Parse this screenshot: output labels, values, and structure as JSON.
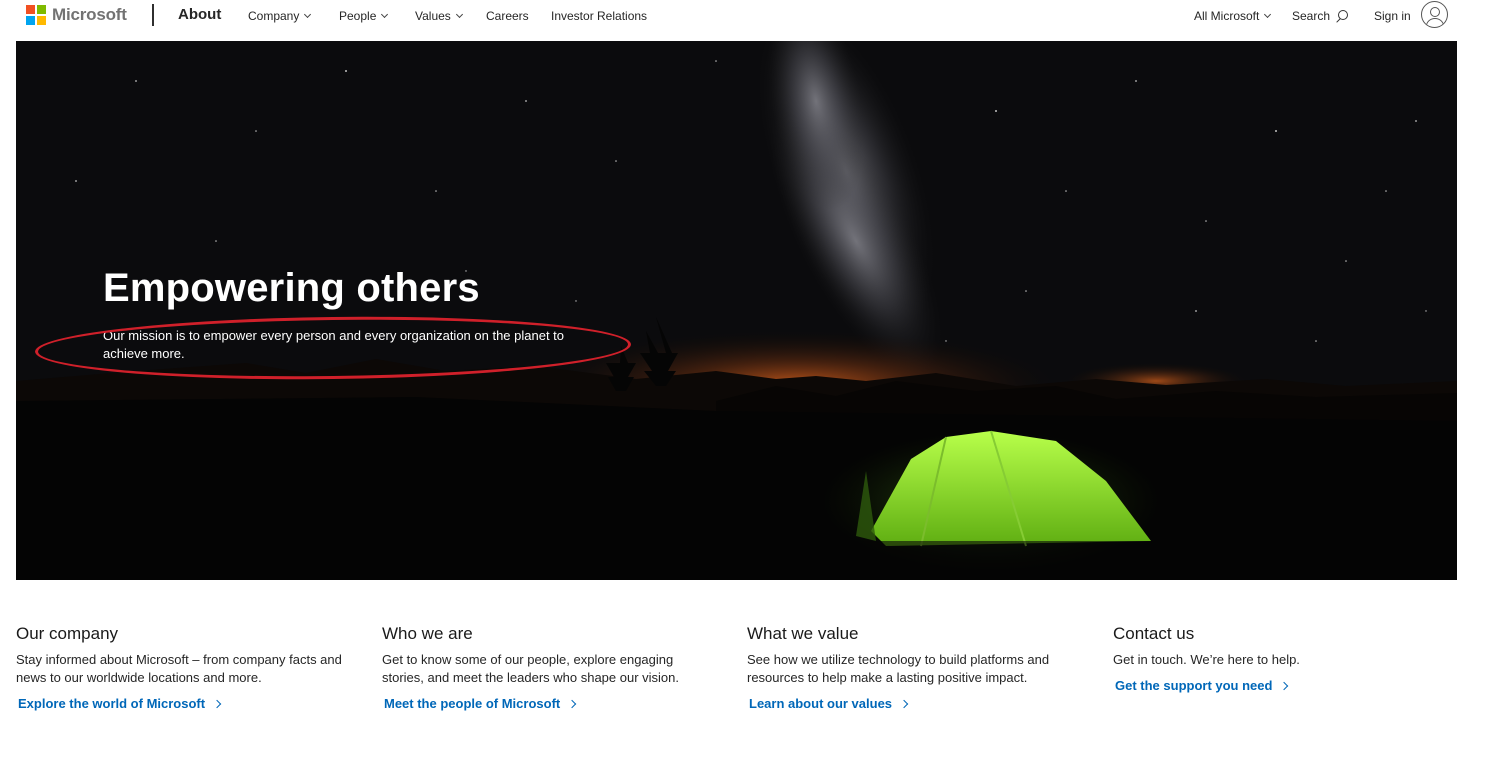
{
  "header": {
    "logo_text": "Microsoft",
    "site_title": "About",
    "nav": [
      {
        "label": "Company",
        "has_dropdown": true
      },
      {
        "label": "People",
        "has_dropdown": true
      },
      {
        "label": "Values",
        "has_dropdown": true
      },
      {
        "label": "Careers",
        "has_dropdown": false
      },
      {
        "label": "Investor Relations",
        "has_dropdown": false
      }
    ],
    "all_microsoft": "All Microsoft",
    "search_label": "Search",
    "sign_in_label": "Sign in"
  },
  "hero": {
    "title": "Empowering others",
    "subtitle": "Our mission is to empower every person and every organization on the planet to achieve more.",
    "annotation_color": "#d0202a"
  },
  "sections": [
    {
      "title": "Our company",
      "text": "Stay informed about Microsoft – from company facts and news to our worldwide locations and more.",
      "link": "Explore the world of Microsoft"
    },
    {
      "title": "Who we are",
      "text": "Get to know some of our people, explore engaging stories, and meet the leaders who shape our vision.",
      "link": "Meet the people of Microsoft"
    },
    {
      "title": "What we value",
      "text": "See how we utilize technology to build platforms and resources to help make a lasting positive impact.",
      "link": "Learn about our values"
    },
    {
      "title": "Contact us",
      "text": "Get in touch. We’re here to help.",
      "link": "Get the support you need"
    }
  ],
  "colors": {
    "link": "#0067b8",
    "logo_red": "#f25022",
    "logo_green": "#7fba00",
    "logo_blue": "#00a4ef",
    "logo_yellow": "#ffb900"
  }
}
